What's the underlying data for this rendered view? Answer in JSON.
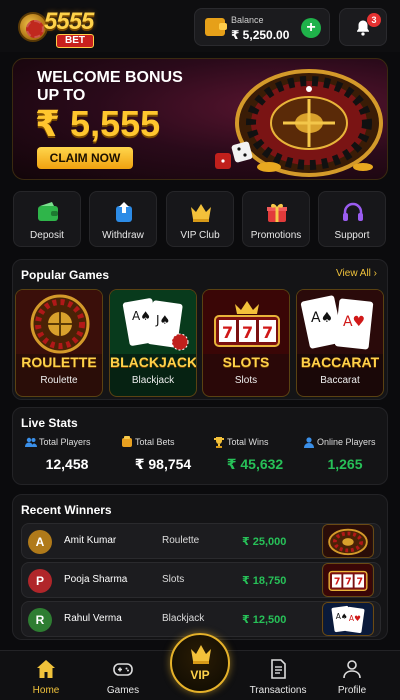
{
  "header": {
    "logo_text": "5555",
    "logo_sub": "BET",
    "balance_label": "Balance",
    "balance_value": "₹ 5,250.00",
    "notification_count": "3"
  },
  "banner": {
    "title_line1": "WELCOME BONUS",
    "title_line2": "UP TO",
    "amount": "₹ 5,555",
    "cta": "CLAIM NOW"
  },
  "quick_actions": [
    {
      "label": "Deposit",
      "icon": "wallet-icon"
    },
    {
      "label": "Withdraw",
      "icon": "withdraw-icon"
    },
    {
      "label": "VIP Club",
      "icon": "crown-icon"
    },
    {
      "label": "Promotions",
      "icon": "gift-icon"
    },
    {
      "label": "Support",
      "icon": "headset-icon"
    }
  ],
  "popular_games": {
    "title": "Popular Games",
    "view_all": "View All",
    "items": [
      {
        "name": "ROULETTE",
        "sub": "Roulette"
      },
      {
        "name": "BLACKJACK",
        "sub": "Blackjack"
      },
      {
        "name": "SLOTS",
        "sub": "Slots"
      },
      {
        "name": "BACCARAT",
        "sub": "Baccarat"
      }
    ]
  },
  "live_stats": {
    "title": "Live Stats",
    "items": [
      {
        "label": "Total Players",
        "value": "12,458",
        "icon": "users-icon"
      },
      {
        "label": "Total Bets",
        "value": "₹ 98,754",
        "icon": "bets-icon"
      },
      {
        "label": "Total Wins",
        "value": "₹ 45,632",
        "icon": "trophy-icon"
      },
      {
        "label": "Online Players",
        "value": "1,265",
        "icon": "user-icon"
      }
    ]
  },
  "recent_winners": {
    "title": "Recent Winners",
    "items": [
      {
        "initial": "A",
        "name": "Amit Kumar",
        "game": "Roulette",
        "amount": "₹ 25,000",
        "avatar_color": "#b07a1a"
      },
      {
        "initial": "P",
        "name": "Pooja Sharma",
        "game": "Slots",
        "amount": "₹ 18,750",
        "avatar_color": "#b0262a"
      },
      {
        "initial": "R",
        "name": "Rahul Verma",
        "game": "Blackjack",
        "amount": "₹ 12,500",
        "avatar_color": "#2e7d32"
      }
    ]
  },
  "bottom_nav": {
    "home": "Home",
    "games": "Games",
    "vip": "VIP",
    "transactions": "Transactions",
    "profile": "Profile"
  },
  "colors": {
    "accent_gold": "#f0c23b",
    "win_green": "#27c158",
    "background": "#0b0b0d"
  }
}
